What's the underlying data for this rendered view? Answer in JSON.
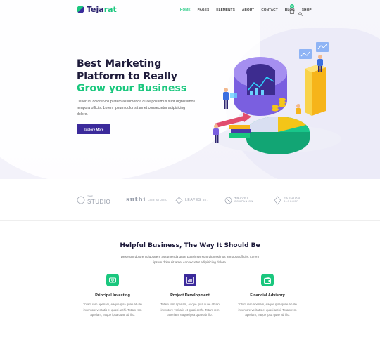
{
  "brand": {
    "name_main": "Teja",
    "name_accent": "rat"
  },
  "nav": {
    "items": [
      "HOME",
      "PAGES",
      "ELEMENTS",
      "ABOUT",
      "CONTACT",
      "BLOG",
      "SHOP"
    ],
    "active_index": 0,
    "cart_count": "0"
  },
  "hero": {
    "title_line1": "Best Marketing",
    "title_line2": "Platform to Really",
    "title_accent": "Grow your Business",
    "description": "Deserunt dolore voluptatem assumenda quae possimus sunt dignissimos tempora officiis. Lorem ipsum dolor sit amet consectetur adipisicing dolore.",
    "button_label": "Explore More"
  },
  "brands": [
    {
      "label": "STUDIO",
      "sub": "THE"
    },
    {
      "label": "suthi",
      "sub": "CRM STUDIO"
    },
    {
      "label": "LEAVES",
      "sub": "co."
    },
    {
      "label": "TRAVEL",
      "sub": "COMPANION"
    },
    {
      "label": "FASHION",
      "sub": "BLOGGER"
    }
  ],
  "services": {
    "title": "Helpful Business, The Way It Should Be",
    "description": "Deserunt dolore voluptatem assumenda quae possimus sunt dignissimos tempora officiis. Lorem ipsum dolor sit amet consectetur adipisicing dolore.",
    "cards": [
      {
        "title": "Principal Investing",
        "icon": "money-icon",
        "color": "#1ac77e",
        "desc": "Totam rem aperiam, eaque ipsa quae ab illo inventore veritatis et quasi archi. Totam rem aperiam, eaque ipsa quae ab illo."
      },
      {
        "title": "Project Development",
        "icon": "bar-chart-icon",
        "color": "#3b2a9b",
        "desc": "Totam rem aperiam, eaque ipsa quae ab illo inventore veritatis et quasi archi. Totam rem aperiam, eaque ipsa quae ab illo."
      },
      {
        "title": "Financial Advisory",
        "icon": "wallet-icon",
        "color": "#1ac77e",
        "desc": "Totam rem aperiam, eaque ipsa quae ab illo inventore veritatis et quasi archi. Totam rem aperiam, eaque ipsa quae ab illo."
      }
    ]
  },
  "colors": {
    "accent": "#1ac77e",
    "primary": "#3b2a9b",
    "heading": "#1d1a3a"
  }
}
